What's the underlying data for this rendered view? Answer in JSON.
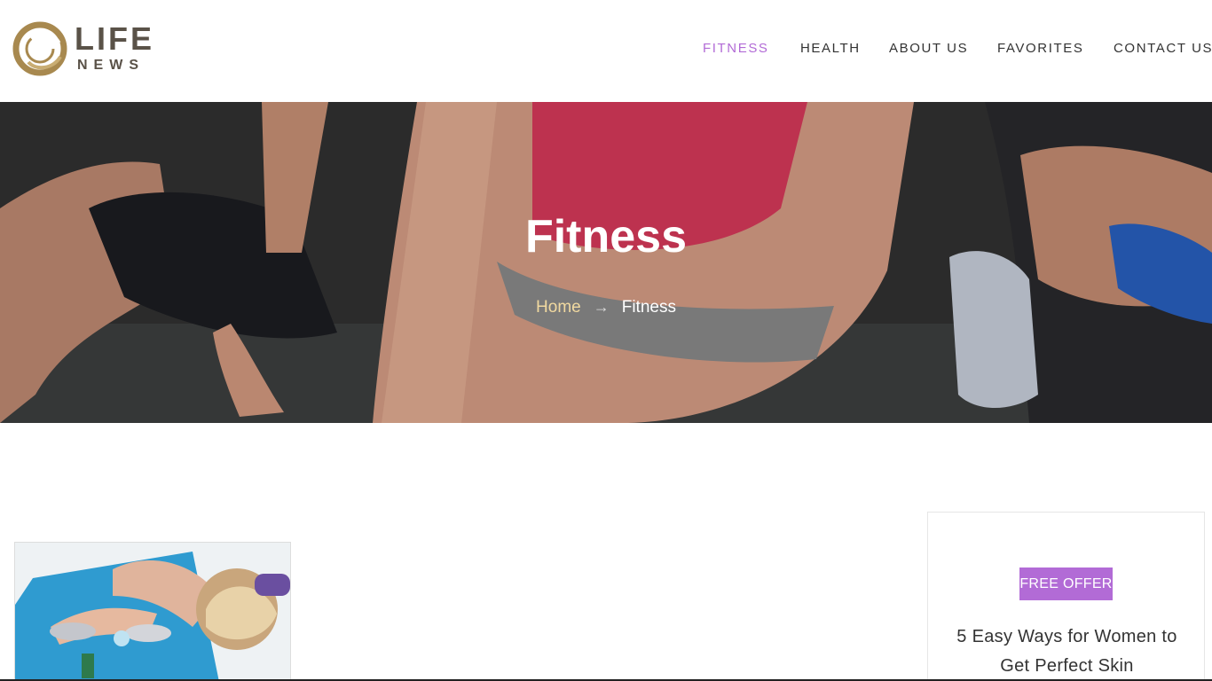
{
  "brand": {
    "logo_top": "LIFE",
    "logo_bottom": "NEWS",
    "logo_color": "#5a5248",
    "ring_color": "#a8894f"
  },
  "nav": {
    "items": [
      {
        "label": "FITNESS",
        "active": true
      },
      {
        "label": "HEALTH",
        "active": false
      },
      {
        "label": "ABOUT US",
        "active": false
      },
      {
        "label": "FAVORITES",
        "active": false
      },
      {
        "label": "CONTACT US",
        "active": false
      }
    ],
    "active_color": "#b26bd6"
  },
  "hero": {
    "title": "Fitness",
    "breadcrumb": {
      "home": "Home",
      "separator": "→",
      "current": "Fitness"
    }
  },
  "sidebar": {
    "badge": "FREE OFFER",
    "title": "5 Easy Ways for Women to Get Perfect Skin",
    "accent": "#b26bd6"
  }
}
